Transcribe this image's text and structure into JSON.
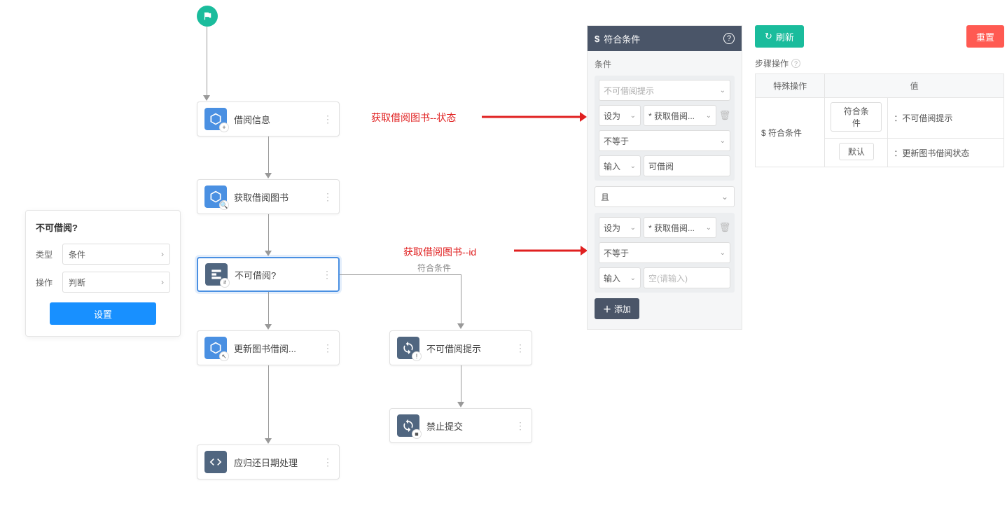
{
  "left_panel": {
    "title": "不可借阅?",
    "type_label": "类型",
    "type_value": "条件",
    "action_label": "操作",
    "action_value": "判断",
    "settings_btn": "设置"
  },
  "nodes": {
    "n1": "借阅信息",
    "n2": "获取借阅图书",
    "n3": "不可借阅?",
    "n4": "更新图书借阅...",
    "n5": "不可借阅提示",
    "n6": "禁止提交",
    "n7": "应归还日期处理"
  },
  "branch_label": "符合条件",
  "annotations": {
    "a1": "获取借阅图书--状态",
    "a2": "获取借阅图书--id"
  },
  "cond_panel": {
    "title": "符合条件",
    "section": "条件",
    "group1": {
      "field_hint": "不可借阅提示",
      "op_label": "设为",
      "op_value": "* 获取借阅...",
      "compare": "不等于",
      "input_label": "输入",
      "input_value": "可借阅"
    },
    "logic": "且",
    "group2": {
      "op_label": "设为",
      "op_value": "* 获取借阅...",
      "compare": "不等于",
      "input_label": "输入",
      "input_placeholder": "空(请输入)"
    },
    "add_btn": "添加"
  },
  "right_panel": {
    "refresh": "刷新",
    "reset": "重置",
    "section": "步骤操作",
    "th1": "特殊操作",
    "th2": "值",
    "row_label": "$ 符合条件",
    "btn1": "符合条件",
    "val1": "：不可借阅提示",
    "btn2": "默认",
    "val2": "：更新图书借阅状态"
  }
}
